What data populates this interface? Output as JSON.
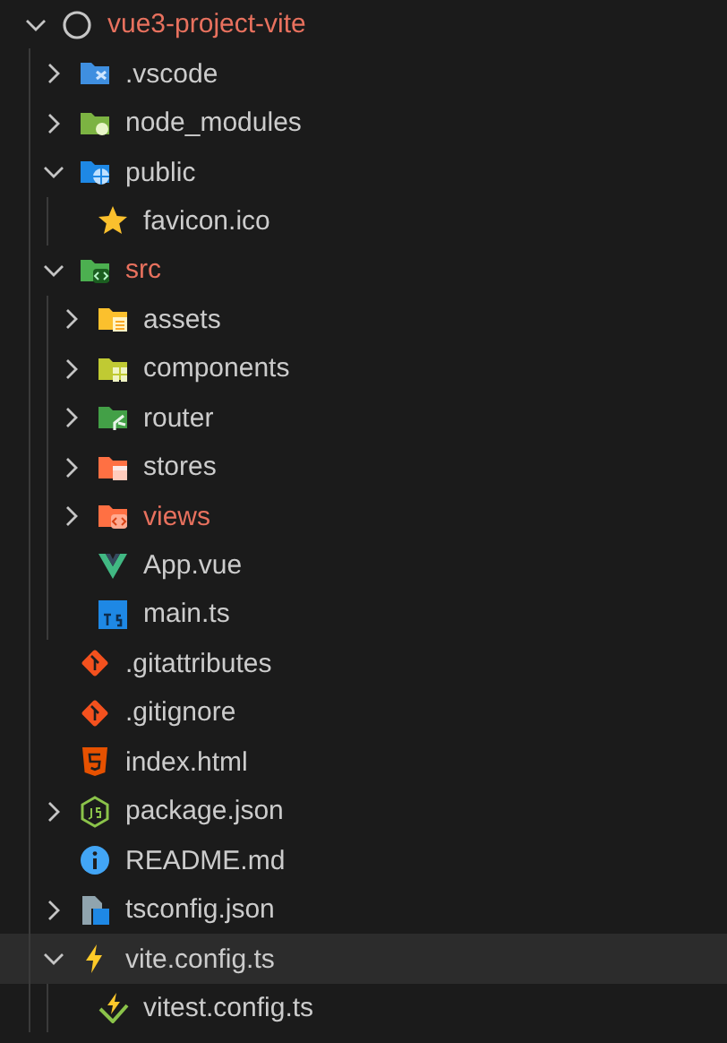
{
  "tree": [
    {
      "label": "vue3-project-vite",
      "kind": "root",
      "expanded": true,
      "modified": true,
      "selected": false,
      "children": [
        {
          "label": ".vscode",
          "kind": "folder-vscode",
          "expanded": false,
          "modified": false,
          "selected": false
        },
        {
          "label": "node_modules",
          "kind": "folder-node",
          "expanded": false,
          "modified": false,
          "selected": false
        },
        {
          "label": "public",
          "kind": "folder-public",
          "expanded": true,
          "modified": false,
          "selected": false,
          "children": [
            {
              "label": "favicon.ico",
              "kind": "star",
              "modified": false,
              "selected": false
            }
          ]
        },
        {
          "label": "src",
          "kind": "folder-src",
          "expanded": true,
          "modified": true,
          "selected": false,
          "children": [
            {
              "label": "assets",
              "kind": "folder-assets",
              "expanded": false,
              "modified": false,
              "selected": false
            },
            {
              "label": "components",
              "kind": "folder-components",
              "expanded": false,
              "modified": false,
              "selected": false
            },
            {
              "label": "router",
              "kind": "folder-router",
              "expanded": false,
              "modified": false,
              "selected": false
            },
            {
              "label": "stores",
              "kind": "folder-stores",
              "expanded": false,
              "modified": false,
              "selected": false
            },
            {
              "label": "views",
              "kind": "folder-views",
              "expanded": false,
              "modified": true,
              "selected": false
            },
            {
              "label": "App.vue",
              "kind": "vue",
              "modified": false,
              "selected": false
            },
            {
              "label": "main.ts",
              "kind": "ts",
              "modified": false,
              "selected": false
            }
          ]
        },
        {
          "label": ".gitattributes",
          "kind": "git",
          "modified": false,
          "selected": false
        },
        {
          "label": ".gitignore",
          "kind": "git",
          "modified": false,
          "selected": false
        },
        {
          "label": "index.html",
          "kind": "html",
          "modified": false,
          "selected": false
        },
        {
          "label": "package.json",
          "kind": "js",
          "expanded": false,
          "modified": false,
          "selected": false
        },
        {
          "label": "README.md",
          "kind": "info",
          "modified": false,
          "selected": false
        },
        {
          "label": "tsconfig.json",
          "kind": "tsconfig",
          "expanded": false,
          "modified": false,
          "selected": false
        },
        {
          "label": "vite.config.ts",
          "kind": "vite",
          "expanded": true,
          "modified": false,
          "selected": true,
          "children": [
            {
              "label": "vitest.config.ts",
              "kind": "vitest",
              "modified": false,
              "selected": false
            }
          ]
        }
      ]
    }
  ]
}
